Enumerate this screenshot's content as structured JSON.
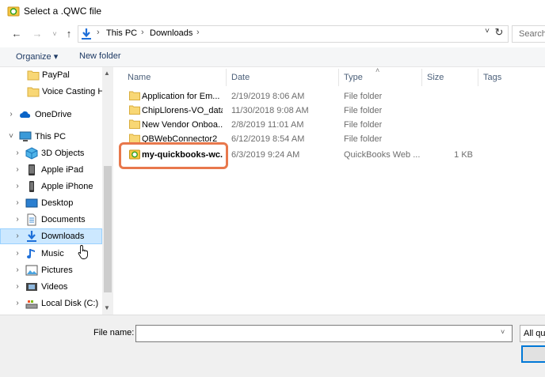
{
  "window": {
    "title": "Select a .QWC file"
  },
  "nav": {
    "back_glyph": "←",
    "forward_glyph": "→",
    "recent_glyph": "˅",
    "up_glyph": "↑"
  },
  "address": {
    "crumbs": [
      "This PC",
      "Downloads"
    ],
    "sep": "›",
    "dropdown_glyph": "˅",
    "refresh_glyph": "↻"
  },
  "search": {
    "placeholder": "Search"
  },
  "toolbar": {
    "organize_label": "Organize ▾",
    "new_folder_label": "New folder"
  },
  "sidebar": {
    "items": [
      {
        "label": "PayPal"
      },
      {
        "label": "Voice Casting Hub"
      },
      {
        "label": "OneDrive"
      },
      {
        "label": "This PC"
      },
      {
        "label": "3D Objects"
      },
      {
        "label": "Apple iPad"
      },
      {
        "label": "Apple iPhone"
      },
      {
        "label": "Desktop"
      },
      {
        "label": "Documents"
      },
      {
        "label": "Downloads"
      },
      {
        "label": "Music"
      },
      {
        "label": "Pictures"
      },
      {
        "label": "Videos"
      },
      {
        "label": "Local Disk (C:)"
      }
    ],
    "chevron_collapsed": "›",
    "chevron_expanded": "˅"
  },
  "columns": {
    "name": "Name",
    "date": "Date",
    "type": "Type",
    "size": "Size",
    "tags": "Tags",
    "sort_glyph": "˄"
  },
  "files": [
    {
      "name": "Application for Em...",
      "date": "2/19/2019 8:06 AM",
      "type": "File folder",
      "size": ""
    },
    {
      "name": "ChipLlorens-VO_data",
      "date": "11/30/2018 9:08 AM",
      "type": "File folder",
      "size": ""
    },
    {
      "name": "New Vendor Onboa...",
      "date": "2/8/2019 11:01 AM",
      "type": "File folder",
      "size": ""
    },
    {
      "name": "QBWebConnector2",
      "date": "6/12/2019 8:54 AM",
      "type": "File folder",
      "size": ""
    },
    {
      "name": "my-quickbooks-wc...",
      "date": "6/3/2019 9:24 AM",
      "type": "QuickBooks Web ...",
      "size": "1 KB"
    }
  ],
  "filename": {
    "label": "File name:",
    "value": "",
    "drop_glyph": "˅"
  },
  "filter": {
    "label": "All qu"
  },
  "colors": {
    "accent": "#0078d7",
    "selection": "#cce8ff",
    "highlight": "#e8784c",
    "folder": "#f8d775"
  }
}
